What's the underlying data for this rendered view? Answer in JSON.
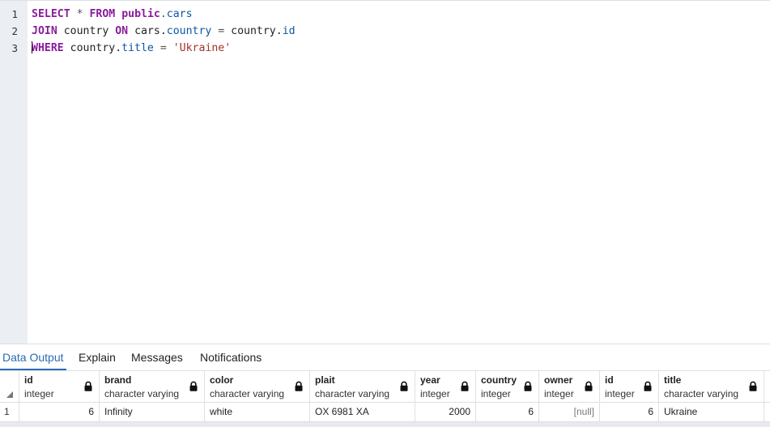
{
  "editor": {
    "line_numbers": [
      "1",
      "2",
      "3"
    ],
    "lines": [
      [
        {
          "t": "SELECT",
          "c": "kw"
        },
        {
          "t": " * ",
          "c": "op"
        },
        {
          "t": "FROM",
          "c": "kw"
        },
        {
          "t": " ",
          "c": "id"
        },
        {
          "t": "public",
          "c": "kw"
        },
        {
          "t": ".",
          "c": "op"
        },
        {
          "t": "cars",
          "c": "prop"
        }
      ],
      [
        {
          "t": "JOIN",
          "c": "kw"
        },
        {
          "t": " country ",
          "c": "id"
        },
        {
          "t": "ON",
          "c": "kw"
        },
        {
          "t": " cars.",
          "c": "id"
        },
        {
          "t": "country",
          "c": "prop"
        },
        {
          "t": " = ",
          "c": "op"
        },
        {
          "t": "country.",
          "c": "id"
        },
        {
          "t": "id",
          "c": "prop"
        }
      ],
      [
        {
          "t": "WHERE",
          "c": "kw"
        },
        {
          "t": " country.",
          "c": "id"
        },
        {
          "t": "title",
          "c": "prop"
        },
        {
          "t": " = ",
          "c": "op"
        },
        {
          "t": "'Ukraine'",
          "c": "str"
        }
      ]
    ]
  },
  "tabs": [
    {
      "label": "Data Output",
      "active": true
    },
    {
      "label": "Explain",
      "active": false
    },
    {
      "label": "Messages",
      "active": false
    },
    {
      "label": "Notifications",
      "active": false
    }
  ],
  "grid": {
    "columns": [
      {
        "name": "id",
        "type": "integer",
        "align": "right"
      },
      {
        "name": "brand",
        "type": "character varying",
        "align": "left"
      },
      {
        "name": "color",
        "type": "character varying",
        "align": "left"
      },
      {
        "name": "plait",
        "type": "character varying",
        "align": "left"
      },
      {
        "name": "year",
        "type": "integer",
        "align": "right"
      },
      {
        "name": "country",
        "type": "integer",
        "align": "right"
      },
      {
        "name": "owner",
        "type": "integer",
        "align": "right"
      },
      {
        "name": "id",
        "type": "integer",
        "align": "right"
      },
      {
        "name": "title",
        "type": "character varying",
        "align": "left"
      }
    ],
    "rows": [
      {
        "num": "1",
        "cells": [
          "6",
          "Infinity",
          "white",
          "OX 6981 XA",
          "2000",
          "6",
          "[null]",
          "6",
          "Ukraine"
        ]
      }
    ]
  },
  "colors": {
    "keyword": "#8a1c9c",
    "property": "#0b57a4",
    "string": "#a1342b",
    "accent": "#2c6bb5"
  }
}
